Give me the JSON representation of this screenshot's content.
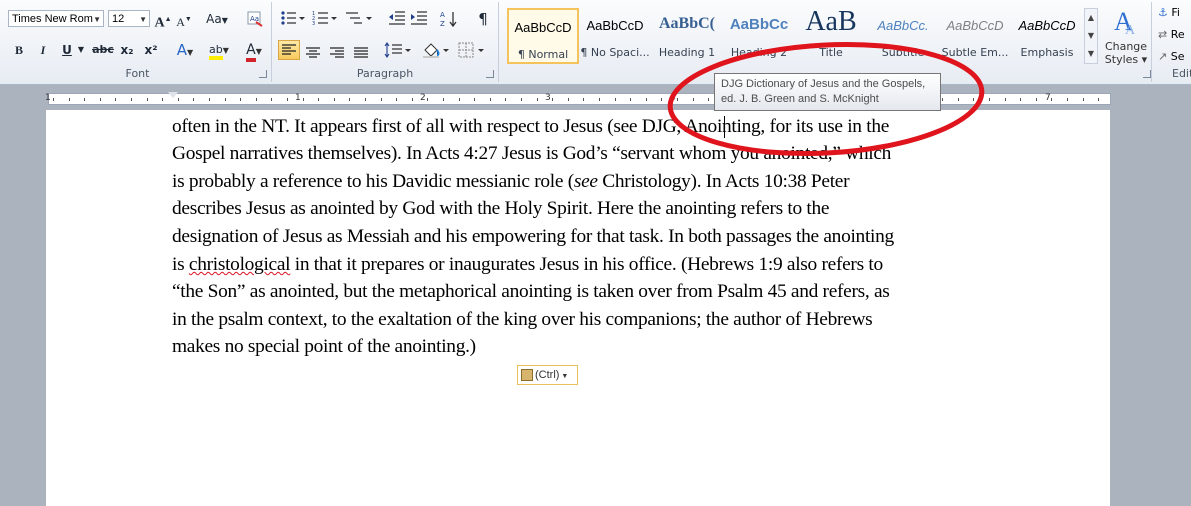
{
  "font_group": {
    "label": "Font",
    "font_name": "Times New Rom",
    "font_size": "12",
    "grow_font": "A",
    "shrink_font": "A",
    "change_case": "Aa",
    "bold": "B",
    "italic": "I",
    "underline": "U",
    "strikethrough": "abc",
    "subscript": "x₂",
    "superscript": "x²",
    "text_effects": "A",
    "highlight": "ab",
    "font_color": "A"
  },
  "paragraph_group": {
    "label": "Paragraph",
    "show_marks": "¶"
  },
  "styles_group": {
    "items": [
      {
        "sample": "AaBbCcD",
        "name": "¶ Normal"
      },
      {
        "sample": "AaBbCcD",
        "name": "¶ No Spaci..."
      },
      {
        "sample": "AaBbC(",
        "name": "Heading 1"
      },
      {
        "sample": "AaBbCc",
        "name": "Heading 2"
      },
      {
        "sample": "AaB",
        "name": "Title"
      },
      {
        "sample": "AaBbCc.",
        "name": "Subtitle"
      },
      {
        "sample": "AaBbCcD",
        "name": "Subtle Em..."
      },
      {
        "sample": "AaBbCcD",
        "name": "Emphasis"
      }
    ],
    "change_styles_line1": "Change",
    "change_styles_line2": "Styles ▾"
  },
  "editing_group": {
    "find": "Fi",
    "replace": "Re",
    "select": "Se",
    "label": "Edit"
  },
  "ruler": {
    "numbers": [
      "1",
      "1",
      "2",
      "3",
      "4",
      "5",
      "6",
      "7"
    ]
  },
  "tooltip": {
    "line1": "DJG Dictionary of Jesus and the Gospels,",
    "line2": "ed. J. B. Green and S. McKnight"
  },
  "document": {
    "lines": [
      "often in the NT. It appears first of all with respect to Jesus (see DJG, Anointing, for its use in the",
      "Gospel narratives themselves). In Acts 4:27 Jesus is God’s “servant whom you anointed,” which",
      "is probably a reference to his Davidic messianic role (",
      "see",
      " Christology). In Acts 10:38 Peter",
      "describes Jesus as anointed by God with the Holy Spirit. Here the anointing refers to the",
      "designation of Jesus as Messiah and his empowering for that task. In both passages the anointing",
      "is ",
      "christological",
      " in that it prepares or inaugurates Jesus in his office. (Hebrews 1:9 also refers to",
      "“the Son” as anointed, but the metaphorical anointing is taken over from Psalm 45 and refers, as",
      "in the psalm context, to the exaltation of the king over his companions; the author of Hebrews",
      "makes no special point of the anointing.)"
    ]
  },
  "paste_options": {
    "label": "(Ctrl)"
  },
  "colors": {
    "annotation_ellipse": "#e0141c",
    "selected_style_border": "#f5c35b",
    "spell_error": "#dd1122"
  }
}
